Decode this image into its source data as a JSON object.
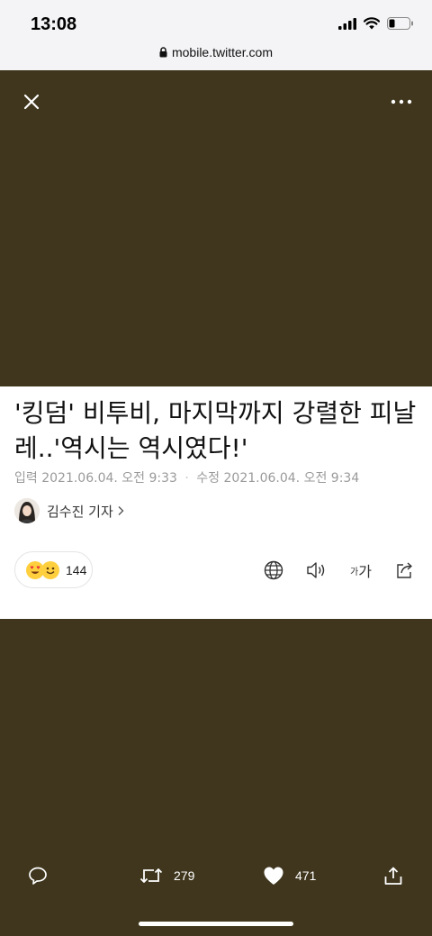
{
  "status": {
    "time": "13:08"
  },
  "browser": {
    "url": "mobile.twitter.com"
  },
  "article": {
    "headline": "'킹덤' 비투비, 마지막까지 강렬한 피날레..'역시는 역시였다!'",
    "input_label": "입력",
    "input_time": "2021.06.04. 오전 9:33",
    "edit_label": "수정",
    "edit_time": "2021.06.04. 오전 9:34",
    "author": "김수진 기자",
    "reaction_count": "144",
    "font_small": "가",
    "font_big": "가"
  },
  "tweet_actions": {
    "retweets": "279",
    "likes": "471"
  },
  "colors": {
    "background": "#3f361d",
    "card": "#ffffff",
    "meta_text": "#9a9a9a"
  }
}
